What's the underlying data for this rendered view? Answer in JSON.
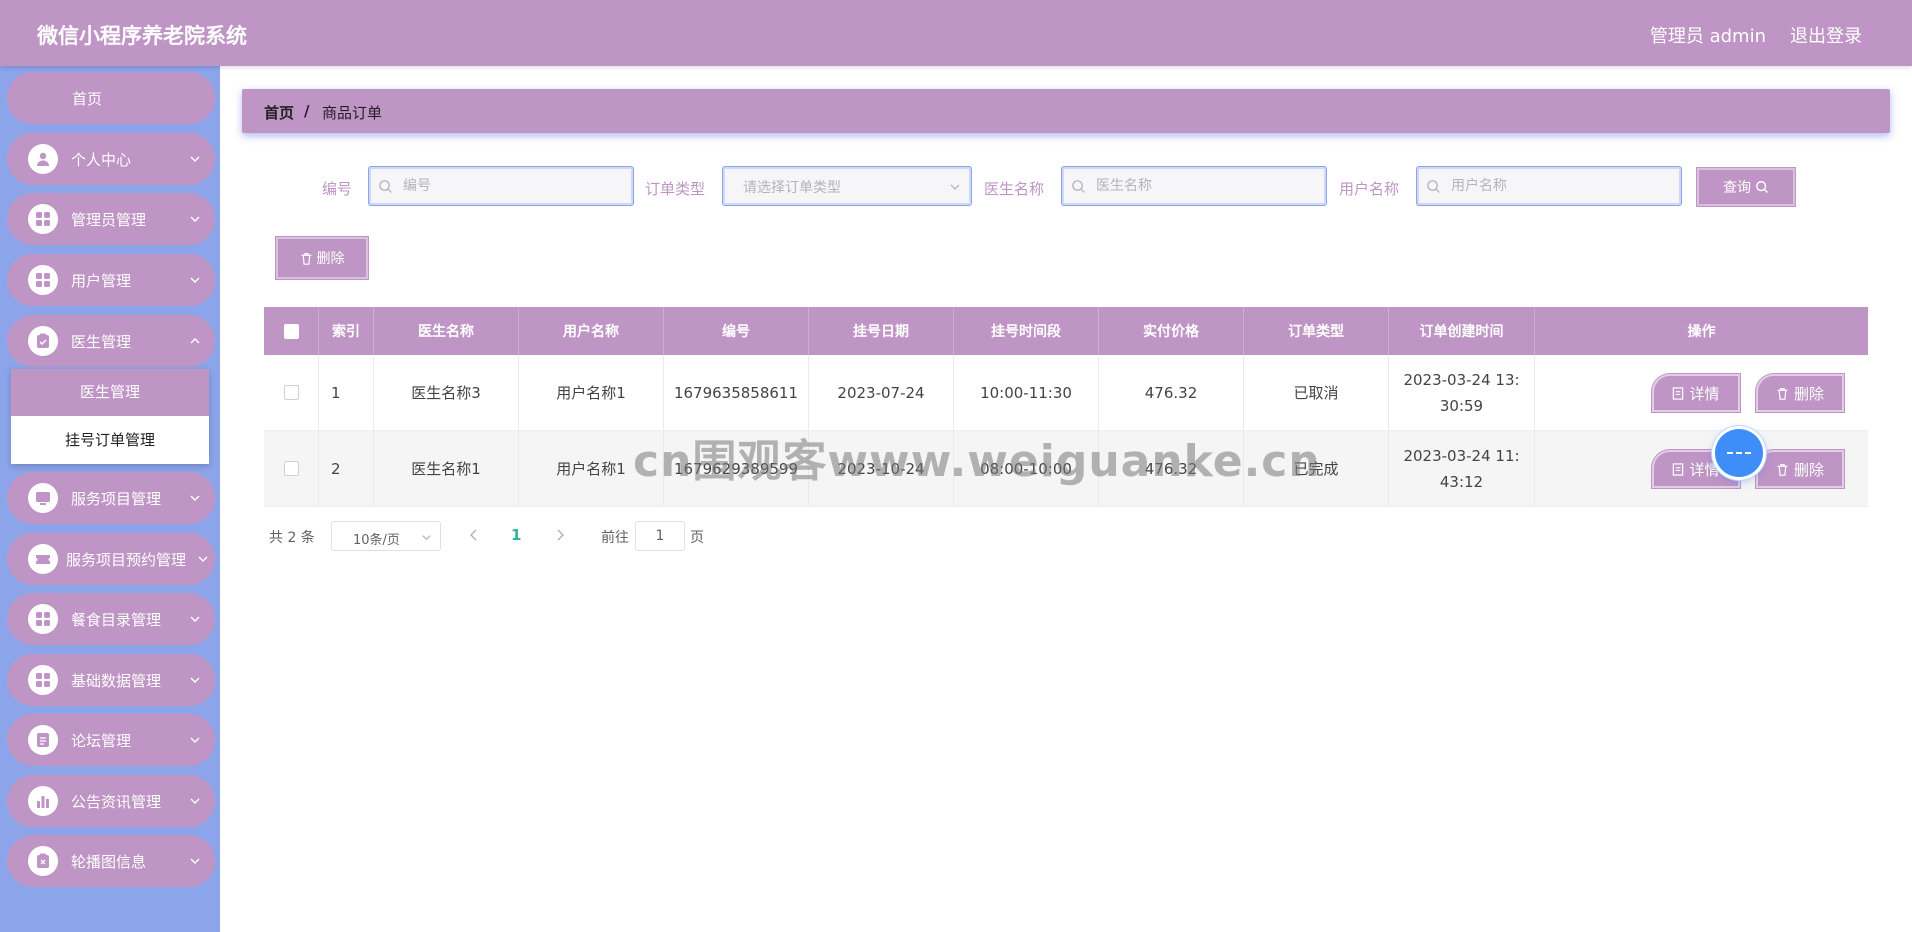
{
  "header": {
    "title": "微信小程序养老院系统",
    "user": "管理员 admin",
    "logout": "退出登录"
  },
  "sidebar": {
    "home": "首页",
    "items": [
      {
        "label": "个人中心",
        "icon": "user-icon"
      },
      {
        "label": "管理员管理",
        "icon": "grid-icon"
      },
      {
        "label": "用户管理",
        "icon": "grid-icon"
      },
      {
        "label": "医生管理",
        "icon": "clipboard-icon"
      },
      {
        "label": "服务项目管理",
        "icon": "monitor-icon"
      },
      {
        "label": "服务项目预约管理",
        "icon": "ticket-icon"
      },
      {
        "label": "餐食目录管理",
        "icon": "grid-icon"
      },
      {
        "label": "基础数据管理",
        "icon": "grid-icon"
      },
      {
        "label": "论坛管理",
        "icon": "document-icon"
      },
      {
        "label": "公告资讯管理",
        "icon": "bar-chart-icon"
      },
      {
        "label": "轮播图信息",
        "icon": "clipboard-x-icon"
      }
    ],
    "submenu": {
      "active": "医生管理",
      "item": "挂号订单管理"
    }
  },
  "breadcrumb": {
    "home": "首页",
    "separator": "/",
    "current": "商品订单"
  },
  "search": {
    "number_label": "编号",
    "number_placeholder": "编号",
    "order_type_label": "订单类型",
    "order_type_placeholder": "请选择订单类型",
    "doctor_label": "医生名称",
    "doctor_placeholder": "医生名称",
    "user_label": "用户名称",
    "user_placeholder": "用户名称",
    "query_button": "查询"
  },
  "toolbar": {
    "delete_button": "删除"
  },
  "table": {
    "columns": [
      "索引",
      "医生名称",
      "用户名称",
      "编号",
      "挂号日期",
      "挂号时间段",
      "实付价格",
      "订单类型",
      "订单创建时间",
      "操作"
    ],
    "rows": [
      {
        "index": "1",
        "doctor": "医生名称3",
        "user": "用户名称1",
        "number": "1679635858611",
        "date": "2023-07-24",
        "time_slot": "10:00-11:30",
        "price": "476.32",
        "type": "已取消",
        "created": "2023-03-24 13:30:59"
      },
      {
        "index": "2",
        "doctor": "医生名称1",
        "user": "用户名称1",
        "number": "1679629389599",
        "date": "2023-10-24",
        "time_slot": "08:00-10:00",
        "price": "476.32",
        "type": "已完成",
        "created": "2023-03-24 11:43:12"
      }
    ],
    "detail_button": "详情",
    "delete_button": "删除"
  },
  "pagination": {
    "total": "共 2 条",
    "page_size": "10条/页",
    "current_page": "1",
    "goto_label": "前往",
    "goto_value": "1",
    "page_suffix": "页"
  },
  "watermark": "cn围观客www.weiguanke.cn",
  "colors": {
    "primary": "#bf95c5",
    "sidebar": "#8ba4ea",
    "page_active": "#2db7a1"
  }
}
